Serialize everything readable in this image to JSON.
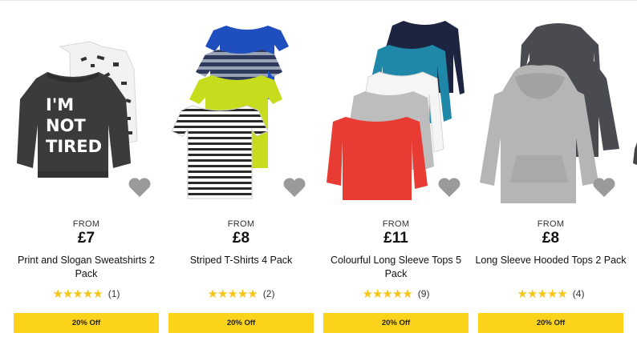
{
  "products": [
    {
      "from_label": "FROM",
      "price": "£7",
      "title": "Print and Slogan Sweatshirts 2 Pack",
      "stars": "★★★★★",
      "review_count": "(1)",
      "offer": "20% Off",
      "slogan": [
        "I'M",
        "NOT",
        "TIRED"
      ]
    },
    {
      "from_label": "FROM",
      "price": "£8",
      "title": "Striped T-Shirts 4 Pack",
      "stars": "★★★★★",
      "review_count": "(2)",
      "offer": "20% Off"
    },
    {
      "from_label": "FROM",
      "price": "£11",
      "title": "Colourful Long Sleeve Tops 5 Pack",
      "stars": "★★★★★",
      "review_count": "(9)",
      "offer": "20% Off"
    },
    {
      "from_label": "FROM",
      "price": "£8",
      "title": "Long Sleeve Hooded Tops 2 Pack",
      "stars": "★★★★★",
      "review_count": "(4)",
      "offer": "20% Off"
    }
  ],
  "colors": {
    "offer_bg": "#fcd31b",
    "star": "#f5c518",
    "heart": "#9a9a9a"
  },
  "icons": {
    "favourite": "heart-icon",
    "rating": "star-icon"
  }
}
